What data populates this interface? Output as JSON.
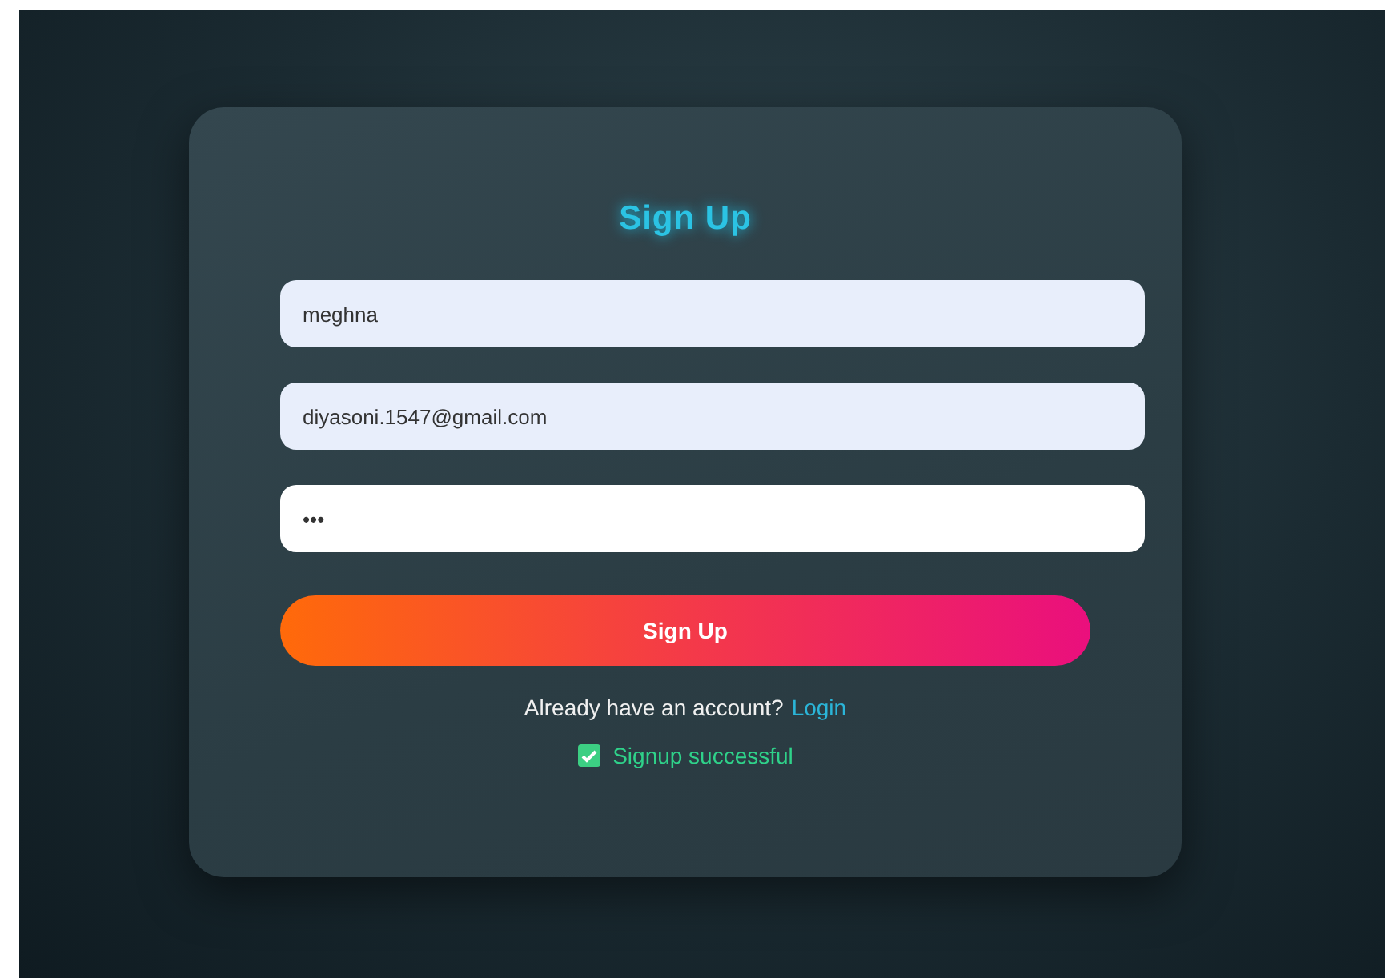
{
  "title": "Sign Up",
  "fields": [
    {
      "value": "meghna",
      "focused": false
    },
    {
      "value": "diyasoni.1547@gmail.com",
      "focused": false
    },
    {
      "value": "•••",
      "focused": true
    }
  ],
  "submit": {
    "label": "Sign Up"
  },
  "prompt": {
    "text": "Already have an account?",
    "link": "Login"
  },
  "status": {
    "text": "Signup successful",
    "checked": true
  }
}
